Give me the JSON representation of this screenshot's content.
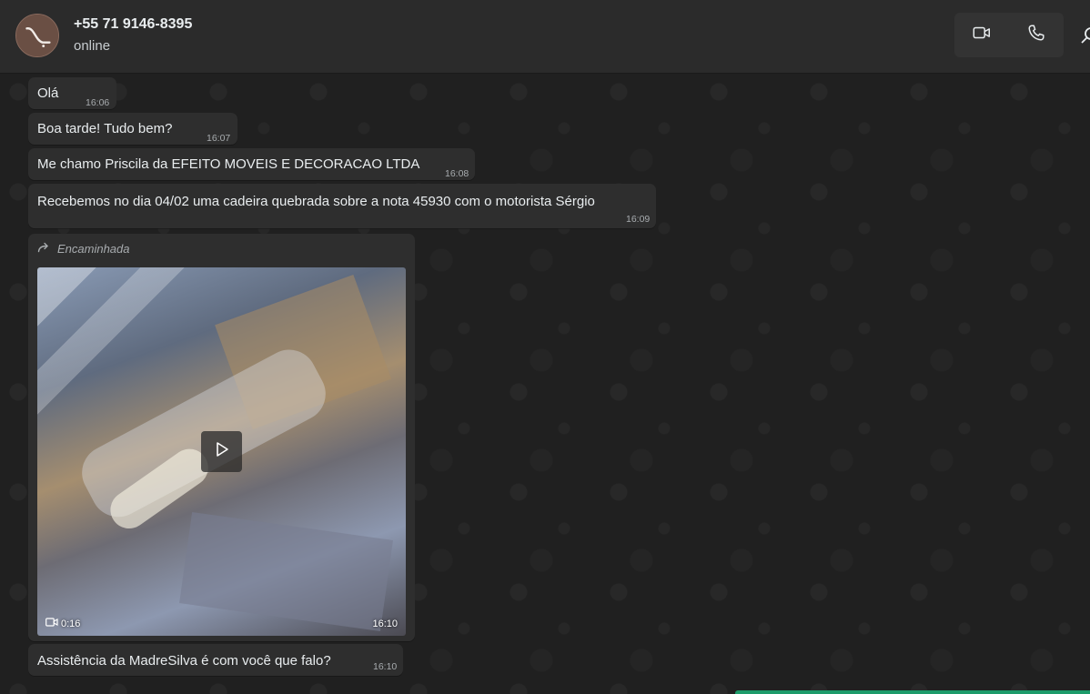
{
  "header": {
    "contact_name": "+55 71 9146-8395",
    "status": "online",
    "video_call_icon": "video-camera-icon",
    "voice_call_icon": "phone-icon",
    "search_icon": "search-icon"
  },
  "messages": [
    {
      "text": "Olá",
      "time": "16:06"
    },
    {
      "text": "Boa tarde! Tudo bem?",
      "time": "16:07"
    },
    {
      "text": "Me chamo Priscila da EFEITO MOVEIS E DECORACAO LTDA",
      "time": "16:08"
    },
    {
      "text": "Recebemos no dia 04/02 uma cadeira quebrada sobre a nota 45930 com o motorista Sérgio",
      "time": "16:09"
    }
  ],
  "video_message": {
    "forwarded_label": "Encaminhada",
    "duration": "0:16",
    "time": "16:10"
  },
  "last_message": {
    "text": "Assistência da MadreSilva é com você que falo?",
    "time": "16:10"
  },
  "colors": {
    "header_bg": "#2b2b2b",
    "bubble_bg": "#2e2e2e",
    "chat_bg": "#202020",
    "accent_green": "#1d9b6a"
  }
}
